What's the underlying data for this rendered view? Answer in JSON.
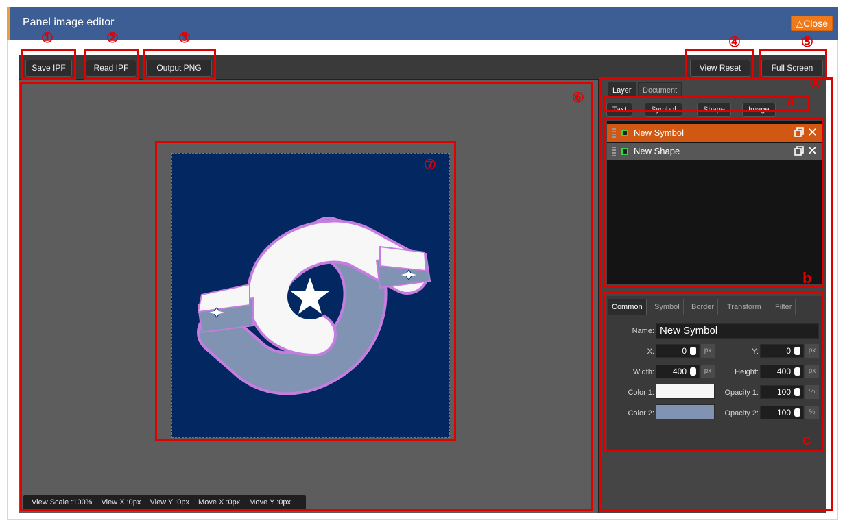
{
  "window": {
    "title": "Panel image editor",
    "close_label": "△Close"
  },
  "toolbar": {
    "save_ipf": "Save IPF",
    "read_ipf": "Read IPF",
    "output_png": "Output PNG",
    "view_reset": "View Reset",
    "full_screen": "Full Screen"
  },
  "status_bar": {
    "view_scale": "View Scale :100%",
    "view_x": "View X :0px",
    "view_y": "View Y :0px",
    "move_x": "Move X :0px",
    "move_y": "Move Y :0px"
  },
  "panel_tabs": [
    {
      "label": "Layer",
      "active": true
    },
    {
      "label": "Document",
      "active": false
    }
  ],
  "add_buttons": [
    "Text",
    "Symbol",
    "Shape",
    "Image"
  ],
  "layers": [
    {
      "name": "New Symbol",
      "selected": true
    },
    {
      "name": "New Shape",
      "selected": false
    }
  ],
  "property_tabs": [
    "Common",
    "Symbol",
    "Border",
    "Transform",
    "Filter"
  ],
  "properties": {
    "name_label": "Name:",
    "name_value": "New Symbol",
    "x_label": "X:",
    "x_value": "0",
    "x_unit": "px",
    "y_label": "Y:",
    "y_value": "0",
    "y_unit": "px",
    "width_label": "Width:",
    "width_value": "400",
    "width_unit": "px",
    "height_label": "Height:",
    "height_value": "400",
    "height_unit": "px",
    "color1_label": "Color 1:",
    "color1": "#f7f7f8",
    "opacity1_label": "Opacity 1:",
    "opacity1_value": "100",
    "opacity1_unit": "%",
    "color2_label": "Color 2:",
    "color2": "#8093b2",
    "opacity2_label": "Opacity 2:",
    "opacity2_value": "100",
    "opacity2_unit": "%"
  },
  "annotations": {
    "n1": "①",
    "n2": "②",
    "n3": "③",
    "n4": "④",
    "n5": "⑤",
    "n6": "⑥",
    "n7": "⑦",
    "n8": "⑧",
    "a": "a",
    "b": "b",
    "c": "c"
  },
  "colors": {
    "title_bar": "#3c5e95",
    "close_button": "#f07a1a",
    "selected_layer": "#d05812",
    "doc_background": "#032760",
    "annotation_red": "#e00000"
  }
}
